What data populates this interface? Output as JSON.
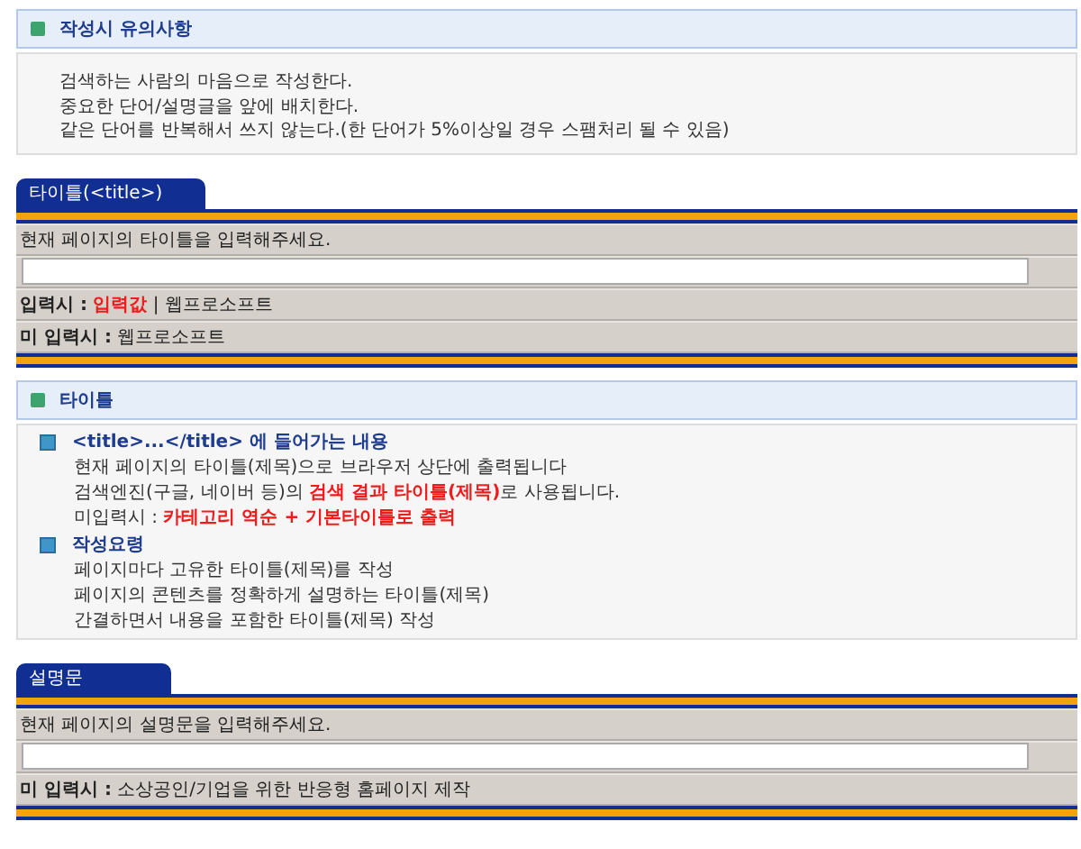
{
  "notice": {
    "title": "작성시 유의사항",
    "lines": [
      "검색하는 사람의 마음으로 작성한다.",
      "중요한 단어/설명글을 앞에 배치한다.",
      "같은 단어를 반복해서 쓰지 않는다.(한 단어가 5%이상일 경우 스팸처리 될 수 있음)"
    ]
  },
  "title_form": {
    "tab": "타이틀(<title>)",
    "prompt": "현재 페이지의 타이틀을 입력해주세요.",
    "rows": [
      {
        "label": "입력시 :",
        "segments": [
          {
            "text": "입력값",
            "highlight": true
          },
          {
            "text": " | 웹프로소프트",
            "highlight": false
          }
        ]
      },
      {
        "label": "미 입력시 :",
        "segments": [
          {
            "text": "웹프로소프트",
            "highlight": false
          }
        ]
      }
    ]
  },
  "title_info": {
    "title": "타이틀",
    "groups": [
      {
        "heading": "<title>...</title> 에 들어가는 내용",
        "lines": [
          [
            {
              "text": "현재 페이지의 타이틀(제목)으로 브라우저 상단에 출력됩니다",
              "highlight": false
            }
          ],
          [
            {
              "text": "검색엔진(구글, 네이버 등)의 ",
              "highlight": false
            },
            {
              "text": "검색 결과 타이틀(제목)",
              "highlight": true
            },
            {
              "text": "로 사용됩니다.",
              "highlight": false
            }
          ],
          [
            {
              "text": "미입력시 : ",
              "highlight": false
            },
            {
              "text": "카테고리 역순 + 기본타이틀로 출력",
              "highlight": true
            }
          ]
        ]
      },
      {
        "heading": "작성요령",
        "lines": [
          [
            {
              "text": "페이지마다 고유한 타이틀(제목)를 작성",
              "highlight": false
            }
          ],
          [
            {
              "text": "페이지의 콘텐츠를 정확하게 설명하는 타이틀(제목)",
              "highlight": false
            }
          ],
          [
            {
              "text": "간결하면서 내용을 포함한 타이틀(제목) 작성",
              "highlight": false
            }
          ]
        ]
      }
    ]
  },
  "description_form": {
    "tab": "설명문",
    "prompt": "현재 페이지의 설명문을 입력해주세요.",
    "rows": [
      {
        "label": "미 입력시 :",
        "segments": [
          {
            "text": "소상공인/기업을 위한 반응형 홈페이지 제작",
            "highlight": false
          }
        ]
      }
    ]
  }
}
